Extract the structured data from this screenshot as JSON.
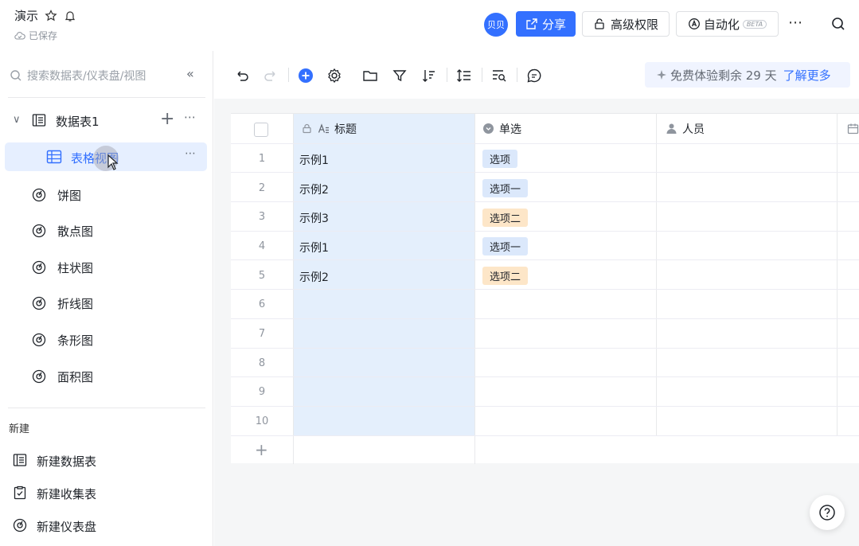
{
  "header": {
    "title": "演示",
    "saved_status": "已保存",
    "avatar_text": "贝贝",
    "share_label": "分享",
    "permission_label": "高级权限",
    "automation_label": "自动化",
    "beta_label": "BETA"
  },
  "sidebar": {
    "search_placeholder": "搜索数据表/仪表盘/视图",
    "table_name": "数据表1",
    "active_view": "表格视图",
    "charts": [
      "饼图",
      "散点图",
      "柱状图",
      "折线图",
      "条形图",
      "面积图"
    ],
    "new_section_title": "新建",
    "new_items": [
      "新建数据表",
      "新建收集表",
      "新建仪表盘"
    ]
  },
  "toolbar": {
    "trial_text": "免费体验剩余 29 天",
    "learn_more": "了解更多"
  },
  "grid": {
    "columns": [
      "标题",
      "单选",
      "人员"
    ],
    "rows": [
      {
        "num": "1",
        "title": "示例1",
        "option": "选项"
      },
      {
        "num": "2",
        "title": "示例2",
        "option": "选项一"
      },
      {
        "num": "3",
        "title": "示例3",
        "option": "选项二"
      },
      {
        "num": "4",
        "title": "示例1",
        "option": "选项一"
      },
      {
        "num": "5",
        "title": "示例2",
        "option": "选项二"
      },
      {
        "num": "6",
        "title": "",
        "option": ""
      },
      {
        "num": "7",
        "title": "",
        "option": ""
      },
      {
        "num": "8",
        "title": "",
        "option": ""
      },
      {
        "num": "9",
        "title": "",
        "option": ""
      },
      {
        "num": "10",
        "title": "",
        "option": ""
      }
    ],
    "add_row": "+"
  },
  "colors": {
    "accent": "#3370ff",
    "tag_blue": "#dbe8fb",
    "tag_orange": "#fde6c8",
    "title_column": "#e4effc"
  }
}
